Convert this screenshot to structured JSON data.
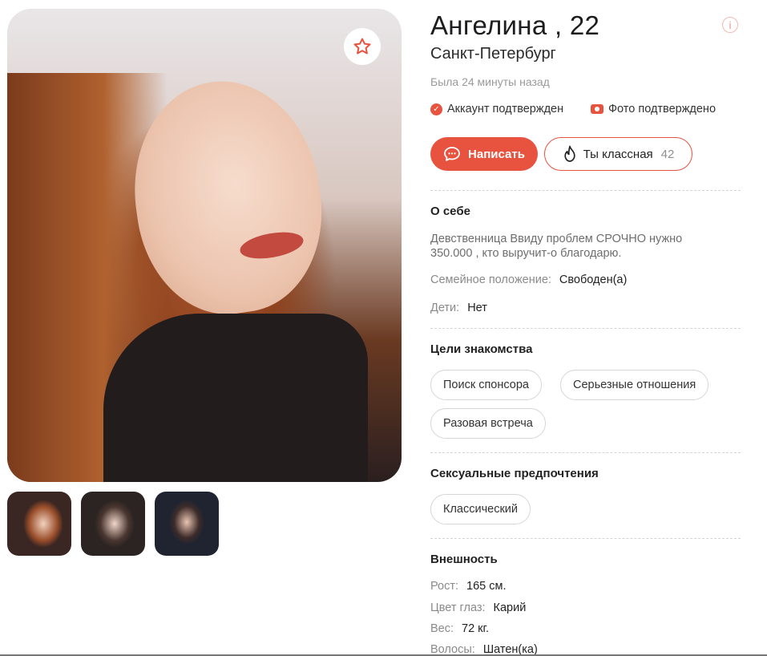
{
  "profile": {
    "name_age": "Ангелина , 22",
    "city": "Санкт-Петербург",
    "last_seen": "Была 24 минуты назад",
    "account_verified": "Аккаунт подтвержден",
    "photo_verified": "Фото подтверждено"
  },
  "actions": {
    "write_label": "Написать",
    "like_label": "Ты классная",
    "like_count": "42"
  },
  "about": {
    "title": "О себе",
    "text": "Девственница Ввиду проблем СРОЧНО нужно 350.000 , кто выручит-о благодарю.",
    "marital_key": "Семейное положение:",
    "marital_value": "Свободен(а)",
    "kids_key": "Дети:",
    "kids_value": "Нет"
  },
  "goals": {
    "title": "Цели знакомства",
    "items": [
      "Поиск спонсора",
      "Серьезные отношения",
      "Разовая встреча"
    ]
  },
  "sexual": {
    "title": "Сексуальные предпочтения",
    "items": [
      "Классический"
    ]
  },
  "appearance": {
    "title": "Внешность",
    "height_key": "Рост:",
    "height_value": "165 см.",
    "eyes_key": "Цвет глаз:",
    "eyes_value": "Карий",
    "weight_key": "Вес:",
    "weight_value": "72 кг.",
    "hair_key": "Волосы:",
    "hair_value": "Шатен(ка)"
  },
  "icons": {
    "favorite": "star-icon",
    "info": "info-icon",
    "chat": "chat-bubble-icon",
    "like": "flame-icon",
    "verified": "check-circle-icon",
    "camera": "camera-icon"
  },
  "colors": {
    "accent": "#e8533f"
  }
}
